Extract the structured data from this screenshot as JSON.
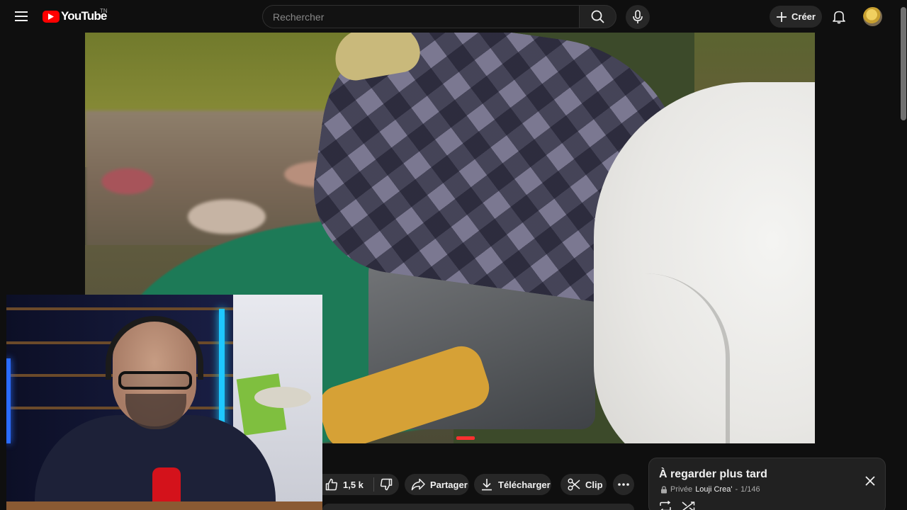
{
  "header": {
    "menu_icon": "hamburger-icon",
    "logo_text": "YouTube",
    "logo_region": "TN",
    "search": {
      "placeholder": "Rechercher",
      "value": ""
    },
    "search_icon": "search-icon",
    "mic_icon": "mic-icon",
    "create_label": "Créer",
    "bell_icon": "bell-icon"
  },
  "actions": {
    "like_count": "1,5 k",
    "share_label": "Partager",
    "download_label": "Télécharger",
    "clip_label": "Clip"
  },
  "playlist": {
    "title": "À regarder plus tard",
    "privacy": "Privée",
    "owner": "Louji Crea'",
    "separator": " - ",
    "position": "1/146"
  },
  "colors": {
    "brand_red": "#ff0000",
    "background": "#0f0f0f",
    "pill": "#272727",
    "panel": "#212121"
  }
}
